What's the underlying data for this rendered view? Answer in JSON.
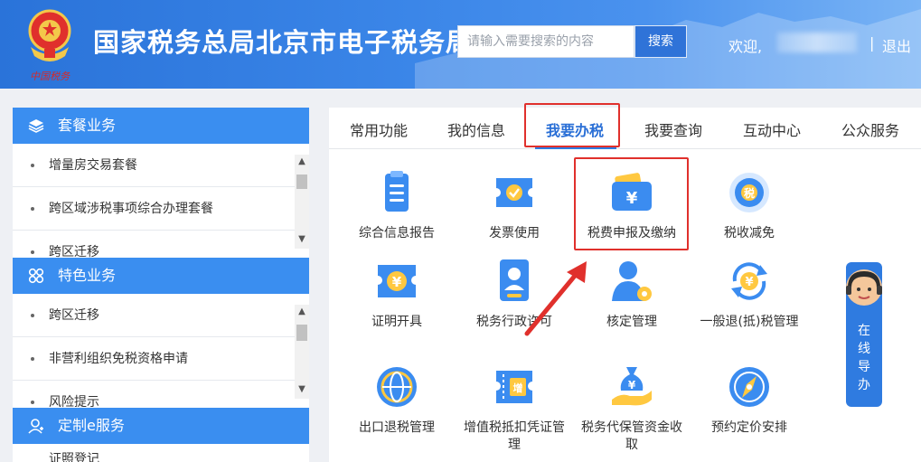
{
  "header": {
    "title": "国家税务总局北京市电子税务局",
    "logo_text": "中国税务",
    "search_placeholder": "请输入需要搜索的内容",
    "search_button": "搜索",
    "welcome": "欢迎,",
    "separator": "|",
    "logout": "退出"
  },
  "sidebar": {
    "sections": [
      {
        "title": "套餐业务",
        "icon": "layers-icon",
        "items": [
          "增量房交易套餐",
          "跨区域涉税事项综合办理套餐",
          "跨区迁移"
        ]
      },
      {
        "title": "特色业务",
        "icon": "grid-icon",
        "items": [
          "跨区迁移",
          "非营利组织免税资格申请",
          "风险提示"
        ]
      },
      {
        "title": "定制e服务",
        "icon": "user-icon",
        "items": [
          "证照登记"
        ]
      }
    ]
  },
  "tabs": {
    "items": [
      "常用功能",
      "我的信息",
      "我要办税",
      "我要查询",
      "互动中心",
      "公众服务"
    ],
    "active_index": 2
  },
  "services": [
    {
      "label": "综合信息报告",
      "icon": "report-icon"
    },
    {
      "label": "发票使用",
      "icon": "invoice-check-icon"
    },
    {
      "label": "税费申报及缴纳",
      "icon": "wallet-yuan-icon"
    },
    {
      "label": "税收减免",
      "icon": "tax-reduction-icon"
    },
    {
      "label": "证明开具",
      "icon": "certificate-yuan-icon"
    },
    {
      "label": "税务行政许可",
      "icon": "license-person-icon"
    },
    {
      "label": "核定管理",
      "icon": "person-gear-icon"
    },
    {
      "label": "一般退(抵)税管理",
      "icon": "refund-cycle-icon"
    },
    {
      "label": "出口退税管理",
      "icon": "globe-icon"
    },
    {
      "label": "增值税抵扣凭证管理",
      "icon": "ticket-icon"
    },
    {
      "label": "税务代保管资金收取",
      "icon": "money-bag-hand-icon"
    },
    {
      "label": "预约定价安排",
      "icon": "compass-icon"
    }
  ],
  "guide": {
    "label": "在线导办"
  },
  "colors": {
    "primary": "#2f7be0",
    "highlight": "#e0302c"
  }
}
